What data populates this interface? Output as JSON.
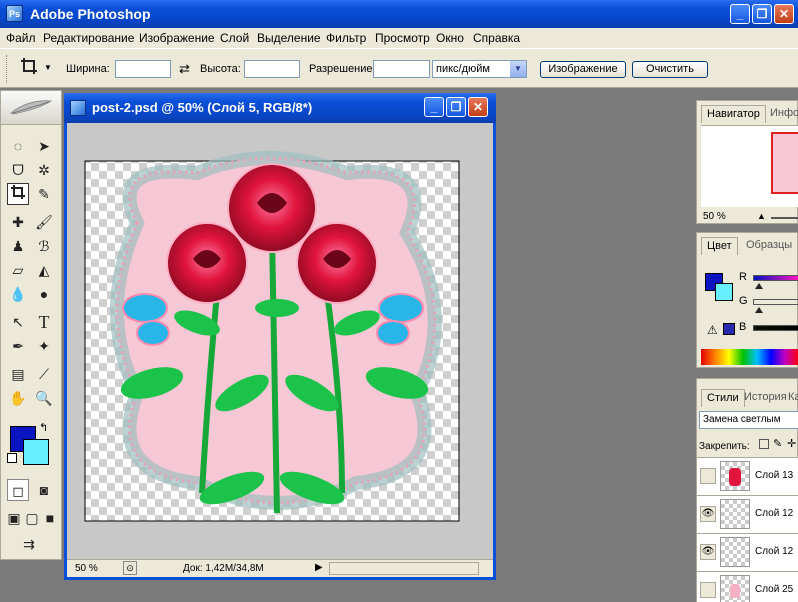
{
  "app": {
    "title": "Adobe Photoshop"
  },
  "window_controls": {
    "minimize": "_",
    "restore": "❐",
    "close": "✕"
  },
  "menu": [
    "Файл",
    "Редактирование",
    "Изображение",
    "Слой",
    "Выделение",
    "Фильтр",
    "Просмотр",
    "Окно",
    "Справка"
  ],
  "options": {
    "width_label": "Ширина:",
    "width_value": "",
    "height_label": "Высота:",
    "height_value": "",
    "resolution_label": "Разрешение:",
    "resolution_value": "",
    "units": "пикс/дюйм",
    "image_button": "Изображение",
    "clear_button": "Очистить"
  },
  "document": {
    "title": "post-2.psd @ 50% (Слой 5, RGB/8*)",
    "zoom": "50 %",
    "doc_info": "Док: 1,42M/34,8M"
  },
  "navigator": {
    "tabs": [
      "Навигатор",
      "Инфо"
    ],
    "zoom": "50 %"
  },
  "color_panel": {
    "tabs": [
      "Цвет",
      "Образцы"
    ],
    "channels": [
      "R",
      "G",
      "B"
    ],
    "foreground": "#0a14c0",
    "background": "#66f0ff"
  },
  "layers_panel": {
    "tabs": [
      "Стили",
      "История",
      "Ка"
    ],
    "blend_mode": "Замена светлым",
    "lock_label": "Закрепить:",
    "layers": [
      {
        "name": "Слой 13",
        "visible": false
      },
      {
        "name": "Слой 12",
        "visible": true
      },
      {
        "name": "Слой 12",
        "visible": true
      },
      {
        "name": "Слой 25",
        "visible": false
      }
    ]
  }
}
